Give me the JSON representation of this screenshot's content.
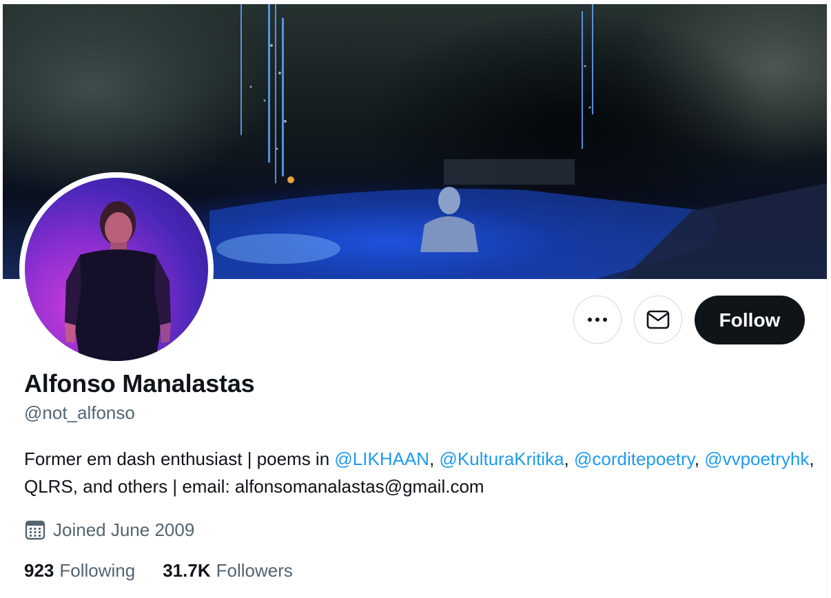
{
  "profile": {
    "name": "Alfonso Manalastas",
    "handle": "@not_alfonso",
    "bio": {
      "intro": "Former em dash enthusiast | poems in ",
      "mention_1": "@LIKHAAN",
      "sep_1": ", ",
      "mention_2": "@KulturaKritika",
      "sep_2": ", ",
      "mention_3": "@corditepoetry",
      "sep_3": ", ",
      "mention_4": "@vvpoetryhk",
      "outro": ", QLRS, and others | email: alfonsomanalastas@gmail.com"
    },
    "joined": "Joined June 2009",
    "following_count": "923",
    "following_label": "Following",
    "followers_count": "31.7K",
    "followers_label": "Followers"
  },
  "actions": {
    "more_icon": "more-horizontal-icon",
    "message_icon": "mail-icon",
    "follow_label": "Follow"
  },
  "colors": {
    "accent": "#1d9bf0",
    "primary_text": "#0f1419",
    "secondary_text": "#536471",
    "follow_bg": "#0f1419"
  }
}
